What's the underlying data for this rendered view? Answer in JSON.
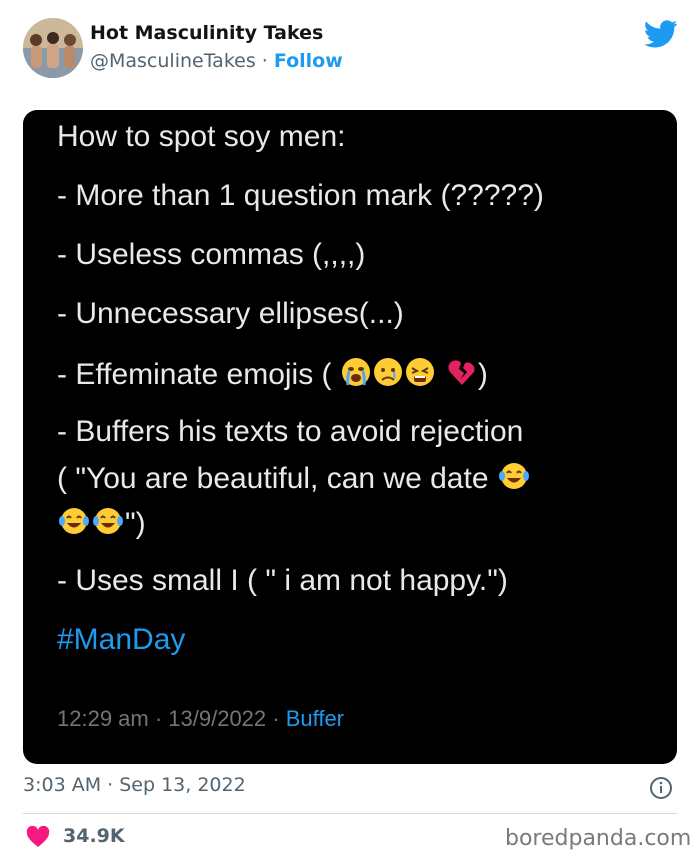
{
  "tweet": {
    "display_name": "Hot Masculinity Takes",
    "handle": "@MasculineTakes",
    "separator": " · ",
    "follow_label": "Follow",
    "timestamp": "3:03 AM · Sep 13, 2022",
    "like_count": "34.9K"
  },
  "card": {
    "line1": "How to spot soy men:",
    "line2": "- More than 1 question mark (?????)",
    "line3": "- Useless commas (,,,,)",
    "line4": "- Unnecessary ellipses(...)",
    "line5_text": "- Effeminate emojis ( ",
    "line5_end": ")",
    "line6": "- Buffers his texts to avoid rejection",
    "line7": "( \"You are beautiful, can we date ",
    "line8_end": "\")",
    "line9": "- Uses small I ( \" i am not happy.\")",
    "hashtag": "#ManDay",
    "meta_time": "12:29 am · 13/9/2022 · ",
    "meta_source": "Buffer"
  },
  "watermark": "boredpanda.com",
  "colors": {
    "twitter_blue": "#1d9bf0",
    "heart_red": "#f91880",
    "card_bg": "#000000"
  }
}
